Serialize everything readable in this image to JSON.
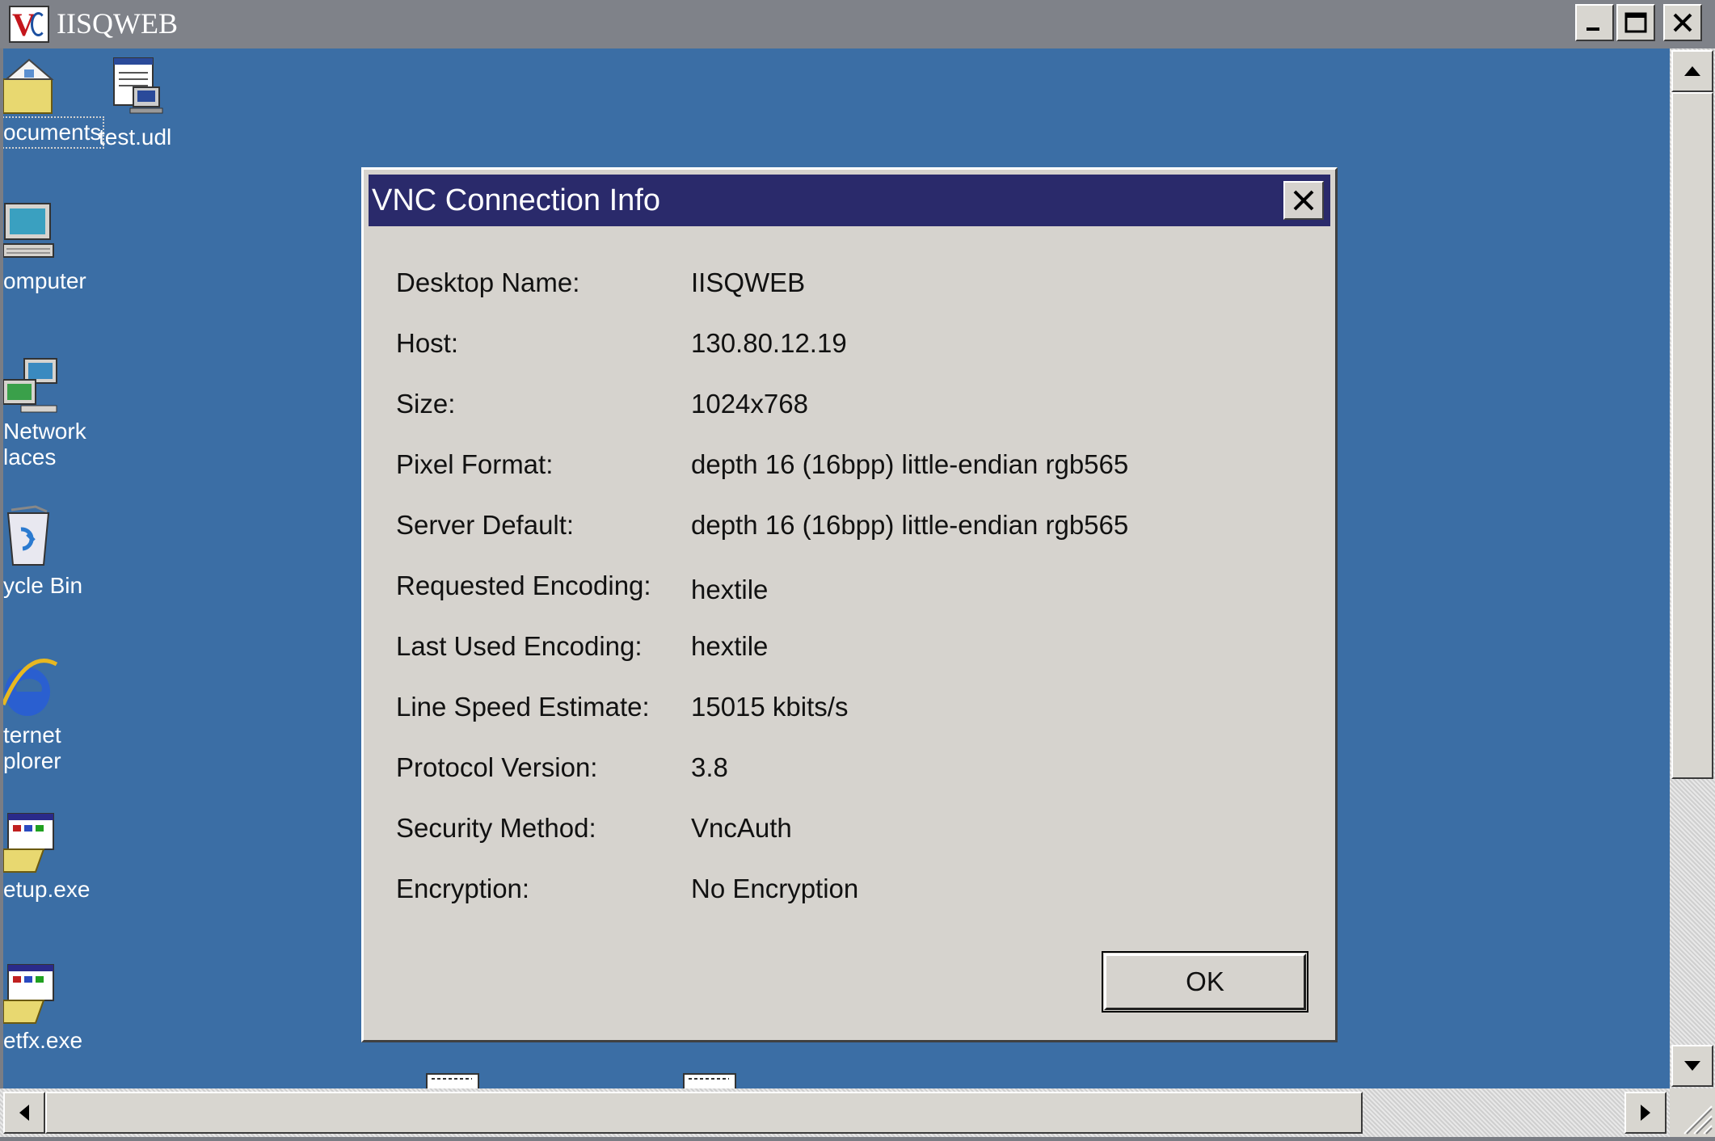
{
  "window": {
    "title": "IISQWEB",
    "controls": [
      "minimize",
      "maximize",
      "close"
    ]
  },
  "desktop": {
    "background": "#3b6ea5",
    "icons": [
      {
        "label": "ocuments",
        "icon": "my-documents-icon"
      },
      {
        "label": "test.udl",
        "icon": "udl-file-icon"
      },
      {
        "label": "omputer",
        "icon": "my-computer-icon"
      },
      {
        "label": "Network\nlaces",
        "icon": "network-places-icon"
      },
      {
        "label": "ycle Bin",
        "icon": "recycle-bin-icon"
      },
      {
        "label": "ternet\nplorer",
        "icon": "internet-explorer-icon"
      },
      {
        "label": "etup.exe",
        "icon": "setup-exe-icon"
      },
      {
        "label": "etfx.exe",
        "icon": "netfx-exe-icon"
      }
    ]
  },
  "dialog": {
    "title": "VNC Connection Info",
    "title_bar_color": "#2a2a6b",
    "rows": [
      {
        "label": "Desktop Name:",
        "value": "IISQWEB"
      },
      {
        "label": "Host:",
        "value": "130.80.12.19"
      },
      {
        "label": "Size:",
        "value": "1024x768"
      },
      {
        "label": "Pixel Format:",
        "value": "depth 16 (16bpp) little-endian rgb565"
      },
      {
        "label": "Server Default:",
        "value": "depth 16 (16bpp) little-endian rgb565"
      },
      {
        "label": "Requested Encoding:",
        "value": "hextile"
      },
      {
        "label": "Last Used Encoding:",
        "value": "hextile"
      },
      {
        "label": "Line Speed Estimate:",
        "value": "15015 kbits/s"
      },
      {
        "label": "Protocol Version:",
        "value": "3.8"
      },
      {
        "label": "Security Method:",
        "value": "VncAuth"
      },
      {
        "label": "Encryption:",
        "value": "No Encryption"
      }
    ],
    "ok_label": "OK"
  }
}
